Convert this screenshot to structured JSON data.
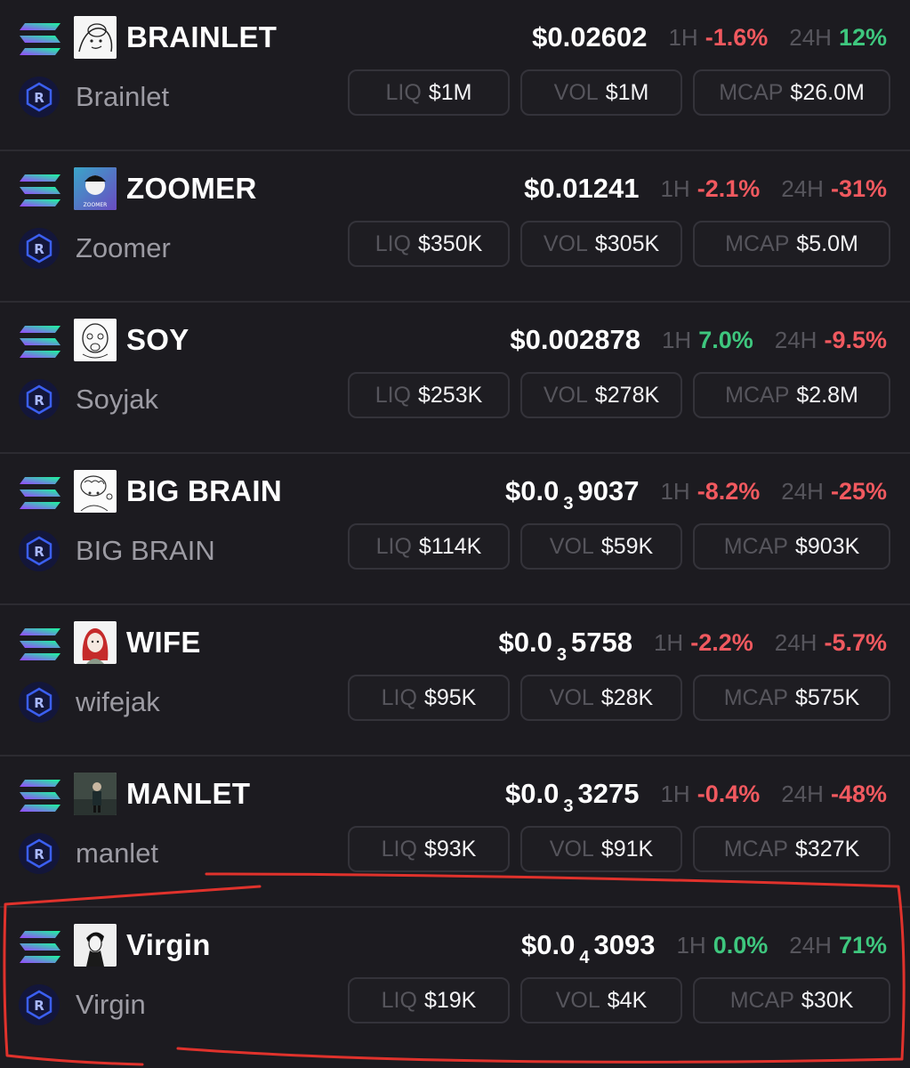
{
  "accent_colors": {
    "positive": "#3ec77e",
    "negative": "#f1595f",
    "annotation": "#e0322c"
  },
  "labels": {
    "h1": "1H",
    "h24": "24H",
    "liq": "LIQ",
    "vol": "VOL",
    "mcap": "MCAP"
  },
  "chain_icon": "solana-logo-icon",
  "dex_icon": "raydium-logo-icon",
  "tokens": [
    {
      "ticker": "BRAINLET",
      "name": "Brainlet",
      "avatar": "brainlet-avatar-icon",
      "price": {
        "lead": "$0.02602",
        "zeros": "",
        "tail": ""
      },
      "change_1h": "-1.6%",
      "change_1h_dir": "neg",
      "change_24h": "12%",
      "change_24h_dir": "pos",
      "liq": "$1M",
      "vol": "$1M",
      "mcap": "$26.0M"
    },
    {
      "ticker": "ZOOMER",
      "name": "Zoomer",
      "avatar": "zoomer-avatar-icon",
      "price": {
        "lead": "$0.01241",
        "zeros": "",
        "tail": ""
      },
      "change_1h": "-2.1%",
      "change_1h_dir": "neg",
      "change_24h": "-31%",
      "change_24h_dir": "neg",
      "liq": "$350K",
      "vol": "$305K",
      "mcap": "$5.0M"
    },
    {
      "ticker": "SOY",
      "name": "Soyjak",
      "avatar": "soyjak-avatar-icon",
      "price": {
        "lead": "$0.002878",
        "zeros": "",
        "tail": ""
      },
      "change_1h": "7.0%",
      "change_1h_dir": "pos",
      "change_24h": "-9.5%",
      "change_24h_dir": "neg",
      "liq": "$253K",
      "vol": "$278K",
      "mcap": "$2.8M"
    },
    {
      "ticker": "BIG BRAIN",
      "name": "BIG BRAIN",
      "avatar": "big-brain-avatar-icon",
      "price": {
        "lead": "$0.0",
        "zeros": "3",
        "tail": "9037"
      },
      "change_1h": "-8.2%",
      "change_1h_dir": "neg",
      "change_24h": "-25%",
      "change_24h_dir": "neg",
      "liq": "$114K",
      "vol": "$59K",
      "mcap": "$903K"
    },
    {
      "ticker": "WIFE",
      "name": "wifejak",
      "avatar": "wifejak-avatar-icon",
      "price": {
        "lead": "$0.0",
        "zeros": "3",
        "tail": "5758"
      },
      "change_1h": "-2.2%",
      "change_1h_dir": "neg",
      "change_24h": "-5.7%",
      "change_24h_dir": "neg",
      "liq": "$95K",
      "vol": "$28K",
      "mcap": "$575K"
    },
    {
      "ticker": "MANLET",
      "name": "manlet",
      "avatar": "manlet-avatar-icon",
      "price": {
        "lead": "$0.0",
        "zeros": "3",
        "tail": "3275"
      },
      "change_1h": "-0.4%",
      "change_1h_dir": "neg",
      "change_24h": "-48%",
      "change_24h_dir": "neg",
      "liq": "$93K",
      "vol": "$91K",
      "mcap": "$327K"
    },
    {
      "ticker": "Virgin",
      "name": "Virgin",
      "avatar": "virgin-avatar-icon",
      "price": {
        "lead": "$0.0",
        "zeros": "4",
        "tail": "3093"
      },
      "change_1h": "0.0%",
      "change_1h_dir": "pos",
      "change_24h": "71%",
      "change_24h_dir": "pos",
      "liq": "$19K",
      "vol": "$4K",
      "mcap": "$30K"
    }
  ]
}
